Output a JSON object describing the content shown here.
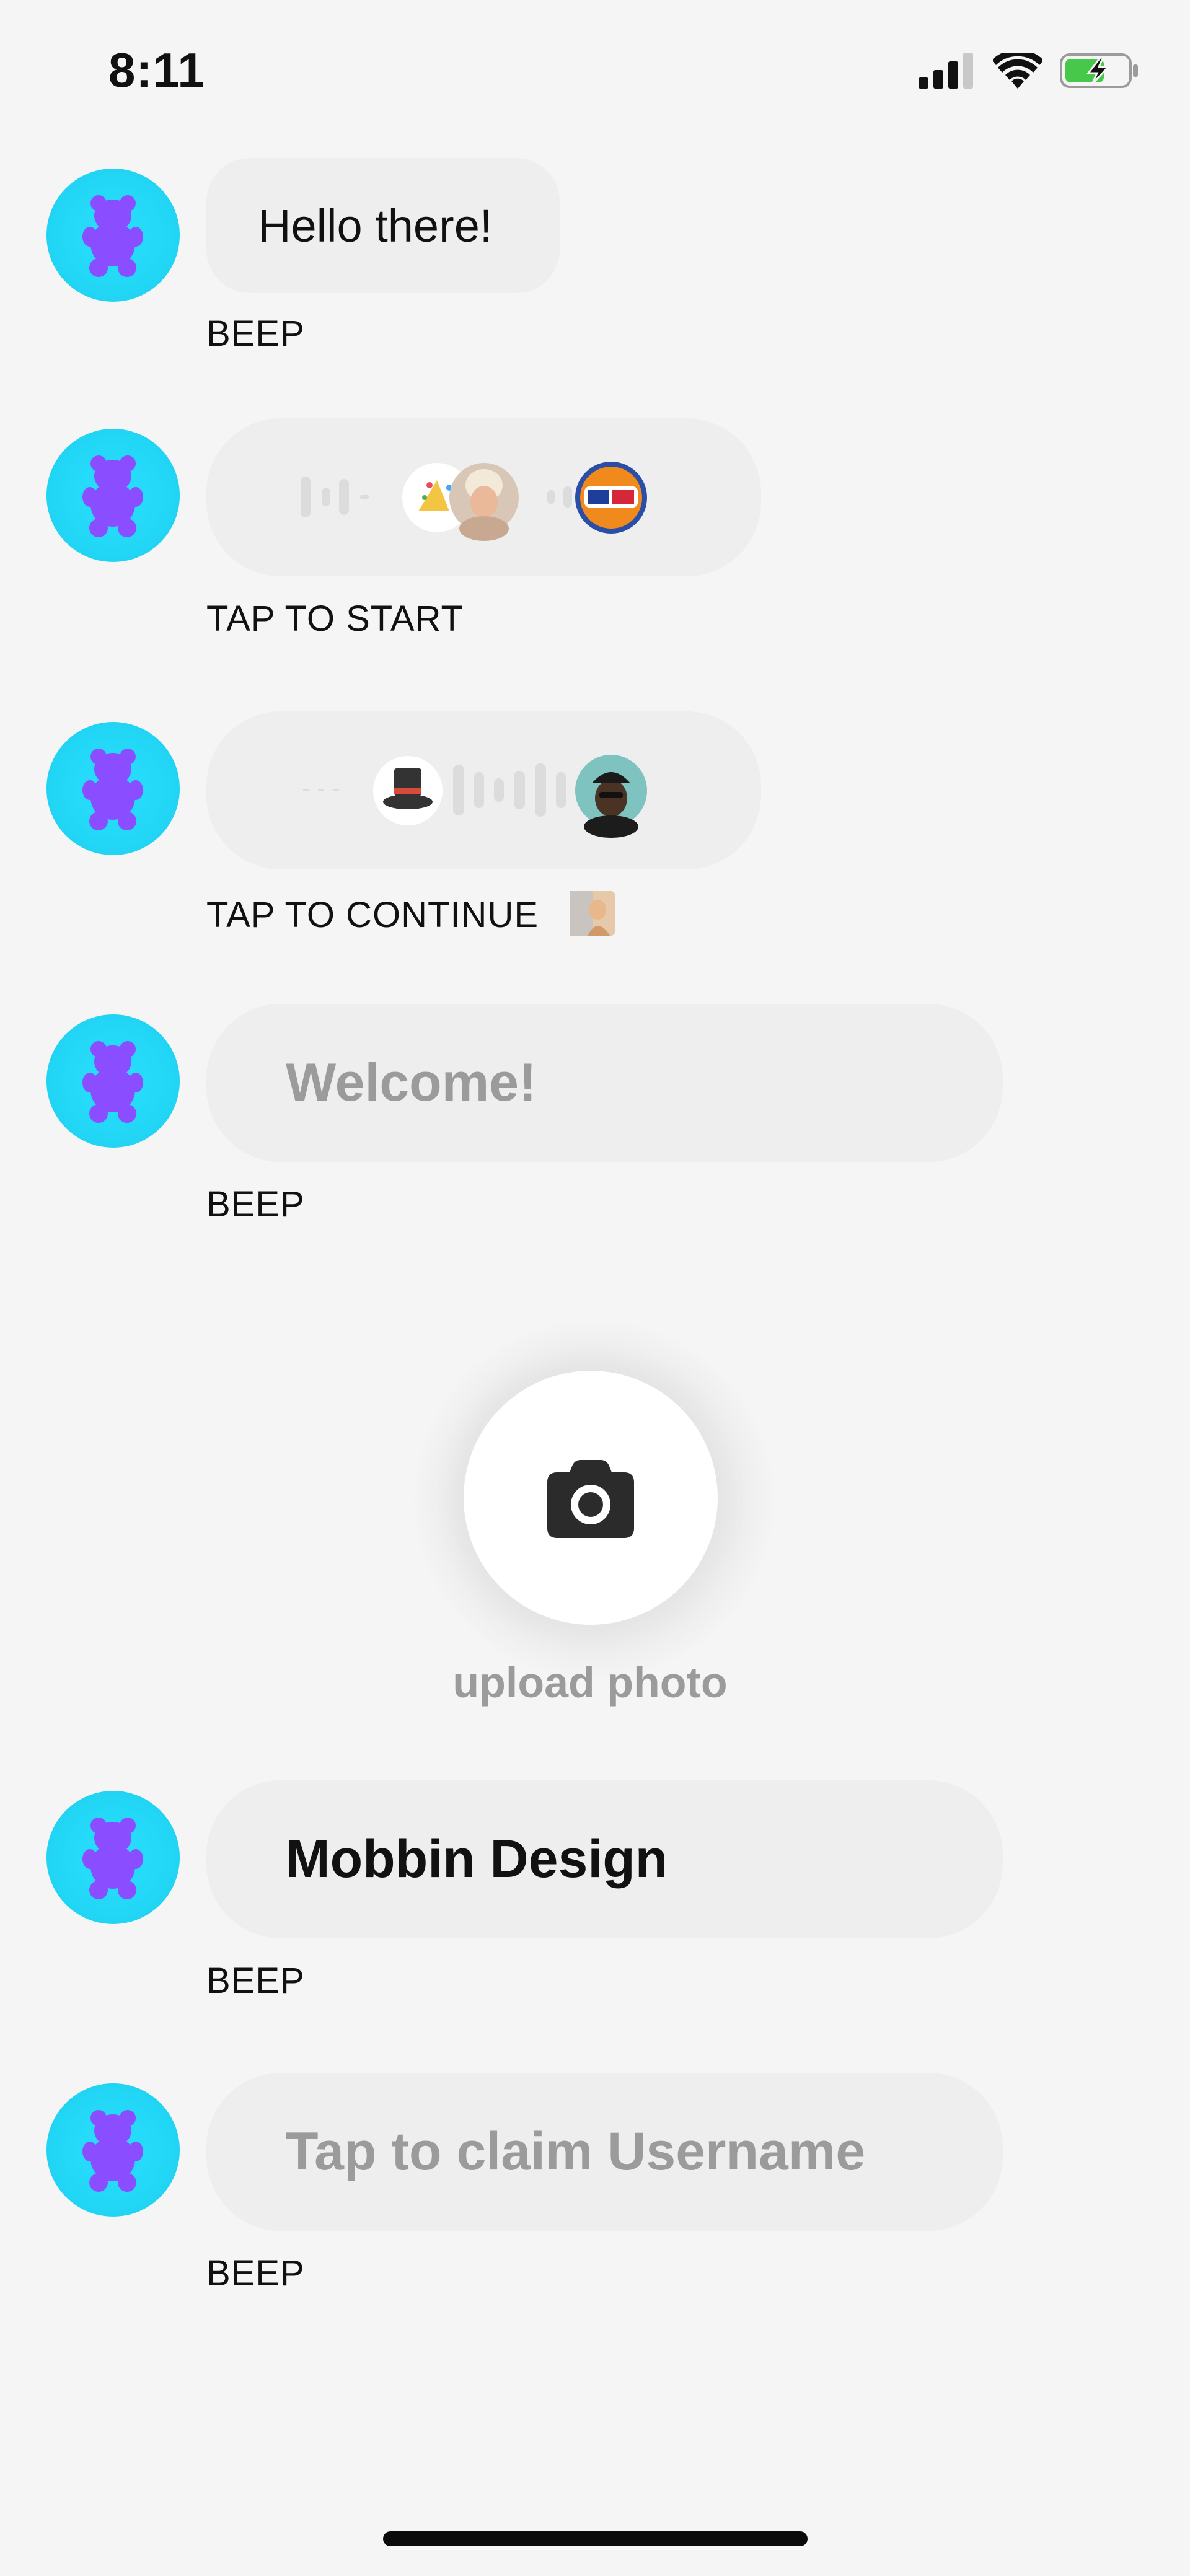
{
  "status_bar": {
    "time": "8:11",
    "icons": [
      "cellular-signal-icon",
      "wifi-icon",
      "battery-charging-icon"
    ]
  },
  "messages": [
    {
      "sender_icon": "gummy-bear-icon",
      "bubble_text": "Hello there!",
      "caption": "BEEP"
    },
    {
      "sender_icon": "gummy-bear-icon",
      "bubble_type": "audio-wave-with-avatars",
      "caption": "TAP TO START"
    },
    {
      "sender_icon": "gummy-bear-icon",
      "bubble_type": "audio-wave-with-avatars",
      "caption": "TAP TO CONTINUE"
    },
    {
      "sender_icon": "gummy-bear-icon",
      "bubble_text": "Welcome!",
      "caption": "BEEP"
    },
    {
      "sender_icon": "gummy-bear-icon",
      "bubble_text": "Mobbin Design",
      "caption": "BEEP"
    },
    {
      "sender_icon": "gummy-bear-icon",
      "bubble_text": "Tap to claim Username",
      "caption": "BEEP"
    }
  ],
  "upload": {
    "icon": "camera-icon",
    "label": "upload photo"
  },
  "colors": {
    "background": "#f5f5f5",
    "bubble": "#eeeeee",
    "avatar_bg": "#22d6f6",
    "bear": "#8a4dff",
    "placeholder_text": "#9b9b9b"
  }
}
